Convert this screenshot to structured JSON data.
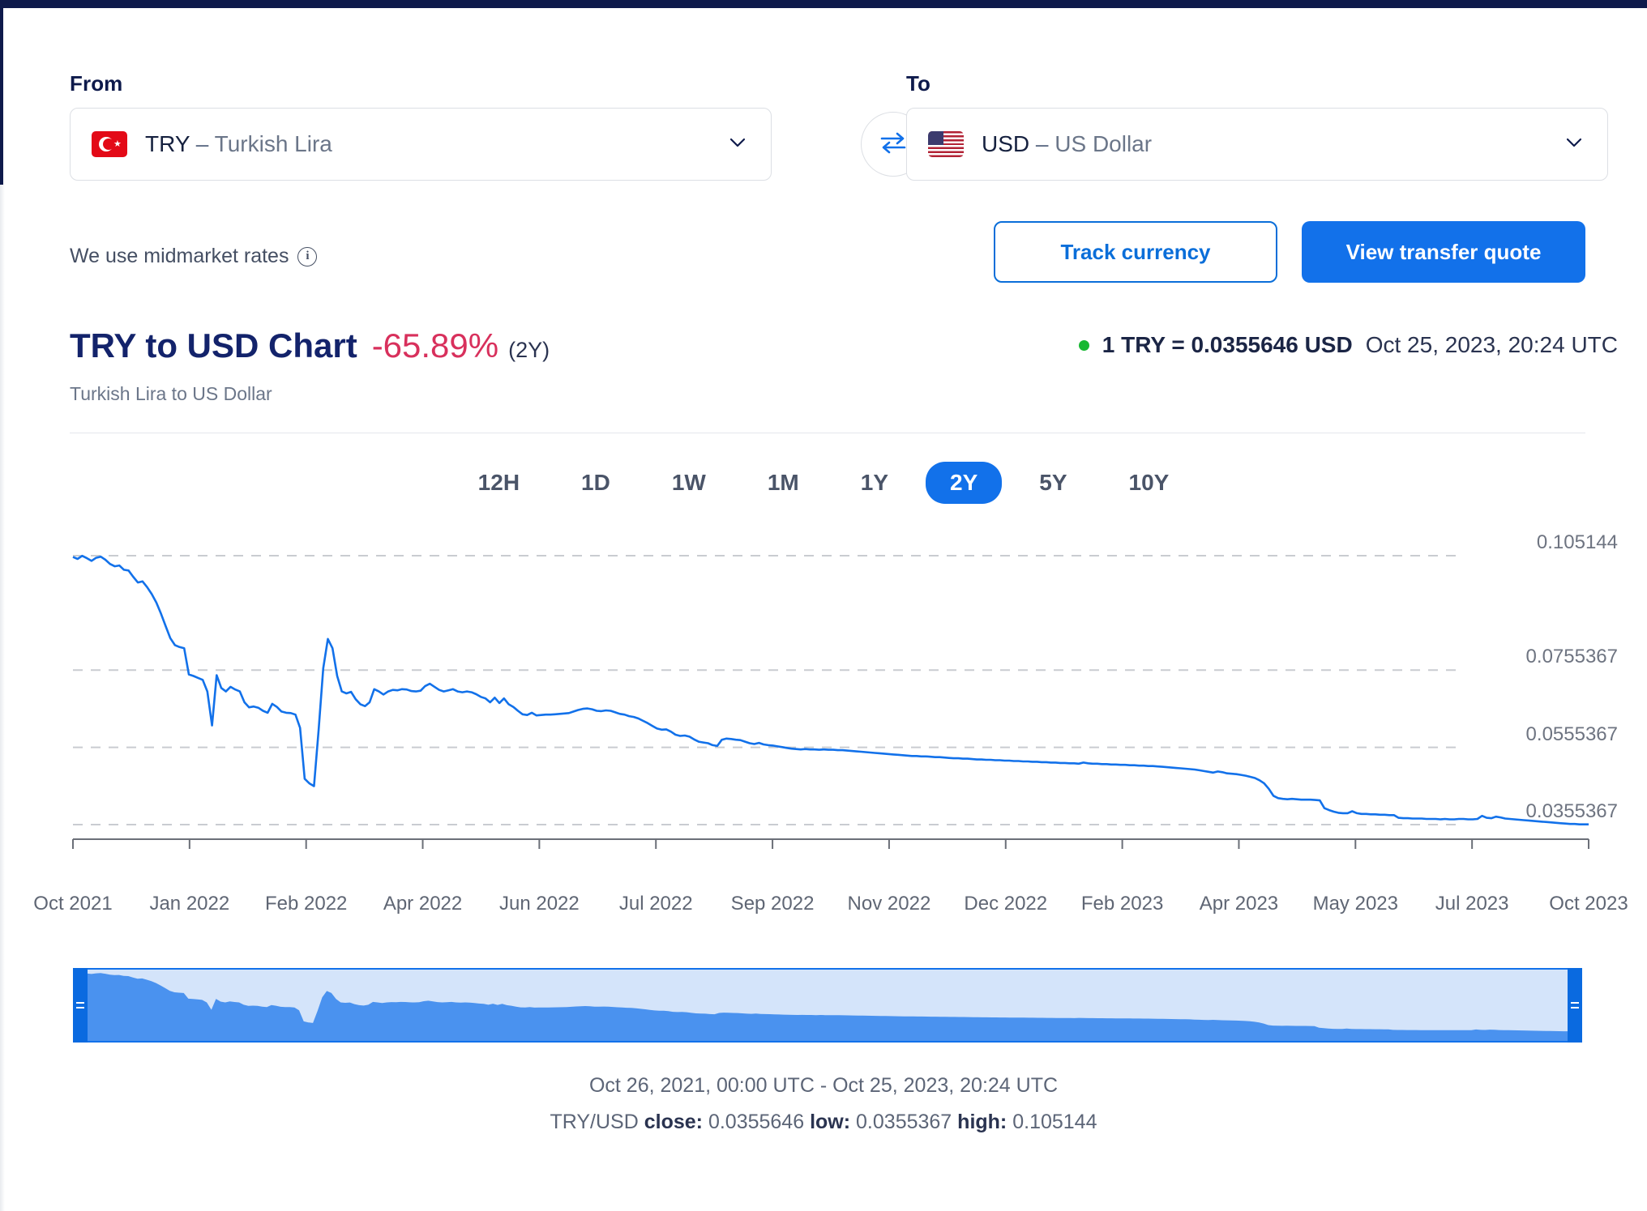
{
  "topbar": {
    "color": "#0e1a4b"
  },
  "converter": {
    "from": {
      "label": "From",
      "flag": "turkey-flag-icon",
      "code": "TRY",
      "dash": "–",
      "name": "Turkish Lira",
      "chevron": "chevron-down-icon"
    },
    "to": {
      "label": "To",
      "flag": "usa-flag-icon",
      "code": "USD",
      "dash": "–",
      "name": "US Dollar",
      "chevron": "chevron-down-icon"
    },
    "swap_icon": "swap-arrows-icon"
  },
  "midmarket": {
    "text": "We use midmarket rates",
    "info_icon": "info-icon",
    "info_glyph": "i"
  },
  "actions": {
    "track": "Track currency",
    "quote": "View transfer quote",
    "outline_color": "#0a6ed9",
    "solid_color": "#1271ea"
  },
  "chart_header": {
    "title": "TRY to USD Chart",
    "change_pct": "-65.89%",
    "change_color": "#d8305c",
    "range_note": "(2Y)",
    "subtitle": "Turkish Lira to US Dollar",
    "status_dot_color": "#17b832",
    "rate": "1 TRY = 0.0355646 USD",
    "timestamp": "Oct 25, 2023, 20:24 UTC"
  },
  "ranges": {
    "options": [
      "12H",
      "1D",
      "1W",
      "1M",
      "1Y",
      "2Y",
      "5Y",
      "10Y"
    ],
    "selected": "2Y"
  },
  "footer": {
    "period": "Oct 26, 2021, 00:00 UTC - Oct 25, 2023, 20:24 UTC",
    "pair": "TRY/USD",
    "close_label": "close:",
    "close_value": "0.0355646",
    "low_label": "low:",
    "low_value": "0.0355367",
    "high_label": "high:",
    "high_value": "0.105144"
  },
  "chart_data": {
    "type": "line",
    "title": "TRY to USD Chart",
    "subtitle": "Turkish Lira to US Dollar",
    "xlabel": "",
    "ylabel": "",
    "series_name": "TRY/USD",
    "line_color": "#1271ea",
    "grid": true,
    "legend": "none",
    "ylim": [
      0.0355367,
      0.105144
    ],
    "ytick_labels": [
      "0.105144",
      "0.0755367",
      "0.0555367",
      "0.0355367"
    ],
    "ytick_values": [
      0.105144,
      0.0755367,
      0.0555367,
      0.0355367
    ],
    "xtick_labels": [
      "Oct 2021",
      "Jan 2022",
      "Feb 2022",
      "Apr 2022",
      "Jun 2022",
      "Jul 2022",
      "Sep 2022",
      "Nov 2022",
      "Dec 2022",
      "Feb 2023",
      "Apr 2023",
      "May 2023",
      "Jul 2023",
      "Oct 2023"
    ],
    "x_start": "Oct 26, 2021, 00:00 UTC",
    "x_end": "Oct 25, 2023, 20:24 UTC",
    "close": 0.0355646,
    "low": 0.0355367,
    "high": 0.105144,
    "change_pct": -65.89,
    "values": [
      0.1048,
      0.1043,
      0.1051,
      0.1045,
      0.1038,
      0.1046,
      0.1049,
      0.1041,
      0.103,
      0.1024,
      0.1026,
      0.1015,
      0.1013,
      0.0997,
      0.0982,
      0.0985,
      0.097,
      0.0952,
      0.093,
      0.0901,
      0.0869,
      0.0838,
      0.082,
      0.0815,
      0.0812,
      0.0744,
      0.074,
      0.0735,
      0.073,
      0.07,
      0.0612,
      0.0742,
      0.0709,
      0.07,
      0.0712,
      0.0705,
      0.07,
      0.0672,
      0.0659,
      0.0661,
      0.0658,
      0.065,
      0.0645,
      0.0668,
      0.066,
      0.0648,
      0.0645,
      0.0644,
      0.064,
      0.0606,
      0.0474,
      0.0462,
      0.0455,
      0.06,
      0.076,
      0.0836,
      0.0812,
      0.074,
      0.07,
      0.0695,
      0.0699,
      0.068,
      0.0667,
      0.0662,
      0.0672,
      0.0706,
      0.07,
      0.0692,
      0.07,
      0.0704,
      0.0703,
      0.0706,
      0.0705,
      0.0701,
      0.07,
      0.0702,
      0.0714,
      0.072,
      0.0712,
      0.0704,
      0.07,
      0.0703,
      0.0706,
      0.07,
      0.0698,
      0.07,
      0.0698,
      0.0693,
      0.0686,
      0.0682,
      0.0672,
      0.0684,
      0.067,
      0.0682,
      0.0667,
      0.066,
      0.065,
      0.0641,
      0.0639,
      0.0645,
      0.0638,
      0.0639,
      0.064,
      0.064,
      0.0641,
      0.0642,
      0.0643,
      0.0644,
      0.0648,
      0.0652,
      0.0655,
      0.0656,
      0.0654,
      0.065,
      0.0649,
      0.0651,
      0.065,
      0.0646,
      0.0642,
      0.064,
      0.0636,
      0.0634,
      0.063,
      0.0624,
      0.0618,
      0.0611,
      0.0604,
      0.0601,
      0.0602,
      0.0596,
      0.0588,
      0.0585,
      0.0586,
      0.0583,
      0.0576,
      0.057,
      0.0568,
      0.0566,
      0.0561,
      0.0559,
      0.0575,
      0.0578,
      0.0577,
      0.0575,
      0.0574,
      0.057,
      0.0566,
      0.0564,
      0.0567,
      0.0563,
      0.0561,
      0.056,
      0.0558,
      0.0556,
      0.0554,
      0.0552,
      0.0551,
      0.055,
      0.0551,
      0.055,
      0.055,
      0.0549,
      0.055,
      0.0549,
      0.0549,
      0.0548,
      0.0548,
      0.0547,
      0.0546,
      0.0545,
      0.0544,
      0.0543,
      0.0542,
      0.0541,
      0.054,
      0.0539,
      0.0538,
      0.0537,
      0.0536,
      0.0535,
      0.0534,
      0.0533,
      0.0533,
      0.0532,
      0.0532,
      0.0531,
      0.053,
      0.053,
      0.0529,
      0.0528,
      0.0527,
      0.0527,
      0.0526,
      0.0526,
      0.0525,
      0.0524,
      0.0524,
      0.0523,
      0.0523,
      0.0522,
      0.0522,
      0.0521,
      0.0521,
      0.052,
      0.052,
      0.0519,
      0.0519,
      0.0518,
      0.0518,
      0.0517,
      0.0517,
      0.0516,
      0.0516,
      0.0515,
      0.0515,
      0.0514,
      0.0514,
      0.0513,
      0.0516,
      0.0514,
      0.0513,
      0.0513,
      0.0512,
      0.0512,
      0.0511,
      0.0511,
      0.051,
      0.051,
      0.0509,
      0.0509,
      0.0508,
      0.0508,
      0.0507,
      0.0507,
      0.0506,
      0.0505,
      0.0504,
      0.0503,
      0.0502,
      0.0501,
      0.05,
      0.0499,
      0.0498,
      0.0496,
      0.0494,
      0.0492,
      0.049,
      0.0493,
      0.0491,
      0.0488,
      0.0487,
      0.0486,
      0.0484,
      0.0482,
      0.0479,
      0.0476,
      0.047,
      0.0462,
      0.0448,
      0.043,
      0.0424,
      0.0422,
      0.0421,
      0.0422,
      0.0421,
      0.042,
      0.042,
      0.042,
      0.0419,
      0.0418,
      0.0398,
      0.0393,
      0.0389,
      0.0386,
      0.0385,
      0.0385,
      0.039,
      0.0385,
      0.0383,
      0.0383,
      0.0382,
      0.0382,
      0.0381,
      0.0381,
      0.038,
      0.038,
      0.0373,
      0.0372,
      0.0372,
      0.0371,
      0.0371,
      0.0371,
      0.037,
      0.037,
      0.037,
      0.0369,
      0.037,
      0.0369,
      0.0369,
      0.037,
      0.037,
      0.0369,
      0.0369,
      0.037,
      0.0378,
      0.0373,
      0.0372,
      0.0376,
      0.0374,
      0.0371,
      0.037,
      0.0369,
      0.0368,
      0.0367,
      0.0366,
      0.0365,
      0.0364,
      0.0363,
      0.0362,
      0.0361,
      0.036,
      0.0359,
      0.0358,
      0.0357,
      0.0357,
      0.0356,
      0.0356,
      0.0356
    ]
  },
  "navigator": {
    "handle_left": "navigator-left-handle",
    "handle_right": "navigator-right-handle",
    "fill_color": "#d4e4fa",
    "series_color": "#4a92ef"
  }
}
